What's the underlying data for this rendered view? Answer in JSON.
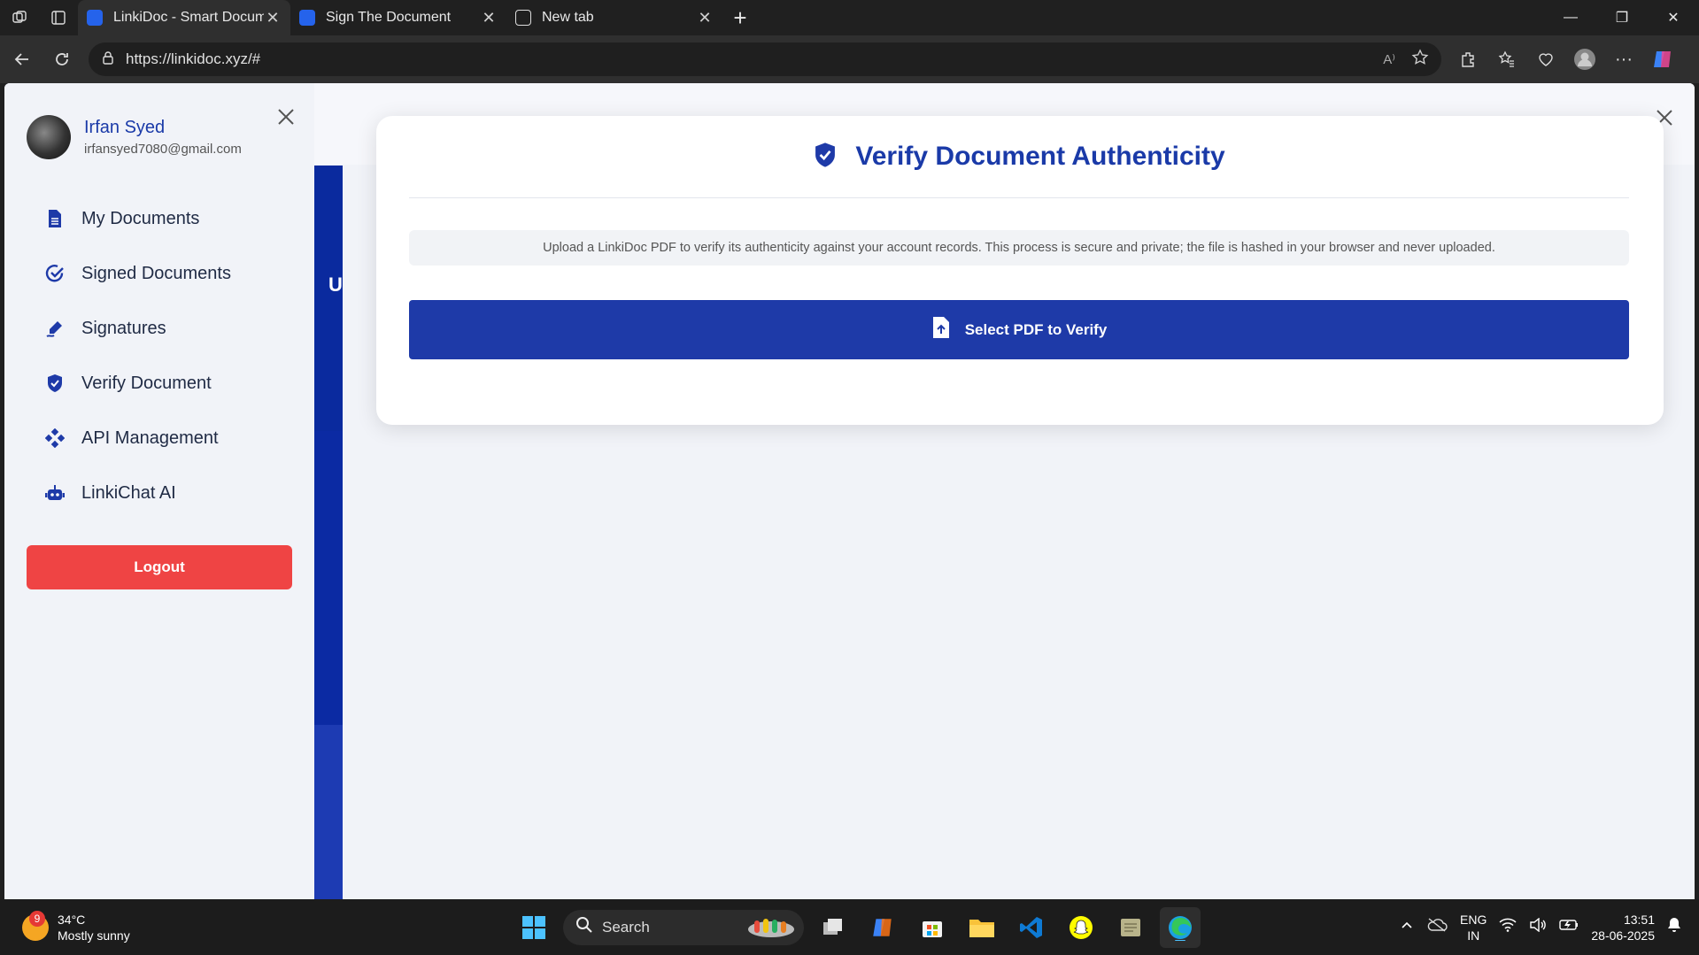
{
  "browser": {
    "tabs": [
      {
        "title": "LinkiDoc - Smart Document Signi",
        "active": true
      },
      {
        "title": "Sign The Document",
        "active": false
      },
      {
        "title": "New tab",
        "active": false
      }
    ],
    "url": "https://linkidoc.xyz/#"
  },
  "sidebar": {
    "user_name": "Irfan Syed",
    "user_email": "irfansyed7080@gmail.com",
    "items": [
      {
        "label": "My Documents",
        "icon": "document-icon"
      },
      {
        "label": "Signed Documents",
        "icon": "check-circle-icon"
      },
      {
        "label": "Signatures",
        "icon": "signature-pen-icon"
      },
      {
        "label": "Verify Document",
        "icon": "shield-check-icon"
      },
      {
        "label": "API Management",
        "icon": "api-nodes-icon"
      },
      {
        "label": "LinkiChat AI",
        "icon": "robot-icon"
      }
    ],
    "logout_label": "Logout"
  },
  "background": {
    "strip_letter": "U"
  },
  "modal": {
    "title": "Verify Document Authenticity",
    "description": "Upload a LinkiDoc PDF to verify its authenticity against your account records. This process is secure and private; the file is hashed in your browser and never uploaded.",
    "button_label": "Select PDF to Verify"
  },
  "taskbar": {
    "weather_badge": "9",
    "temperature": "34°C",
    "condition": "Mostly sunny",
    "search_label": "Search",
    "lang_line1": "ENG",
    "lang_line2": "IN",
    "time": "13:51",
    "date": "28-06-2025"
  },
  "colors": {
    "brand_blue": "#1e3aa8",
    "logout_red": "#ef4444"
  }
}
